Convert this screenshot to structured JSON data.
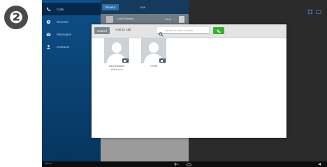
{
  "step_badge": "❷",
  "colors": {
    "accent_blue": "#0e4f88",
    "call_green": "#38b034",
    "cancel_gray": "#7d8a94"
  },
  "sidebar": {
    "items": [
      {
        "label": "Calls",
        "icon": "phone-icon"
      },
      {
        "label": "Recents",
        "icon": "clock-icon"
      },
      {
        "label": "Messages",
        "icon": "message-icon"
      },
      {
        "label": "Contacts",
        "icon": "person-icon"
      }
    ]
  },
  "list": {
    "tabs": [
      "Recent",
      "Live"
    ],
    "rows": [
      {
        "name": "Lara Flowers",
        "detail": "1st call",
        "time": "09:44"
      }
    ]
  },
  "dialog": {
    "cancel_label": "Cancel",
    "title": "Add to call",
    "search_placeholder": "Search or call a number",
    "call_icon": "phone-icon",
    "contacts": [
      {
        "name": "Lara Flowers",
        "sub": "@lara.com",
        "badge_count": "2",
        "badge_icon": "device-icon"
      },
      {
        "name": "TONE",
        "sub": "",
        "badge_count": "2",
        "badge_icon": "device-icon"
      }
    ]
  },
  "system_bar": {
    "left_text": "Admin",
    "icons": [
      "back-icon",
      "home-icon",
      "volume-icon"
    ]
  }
}
